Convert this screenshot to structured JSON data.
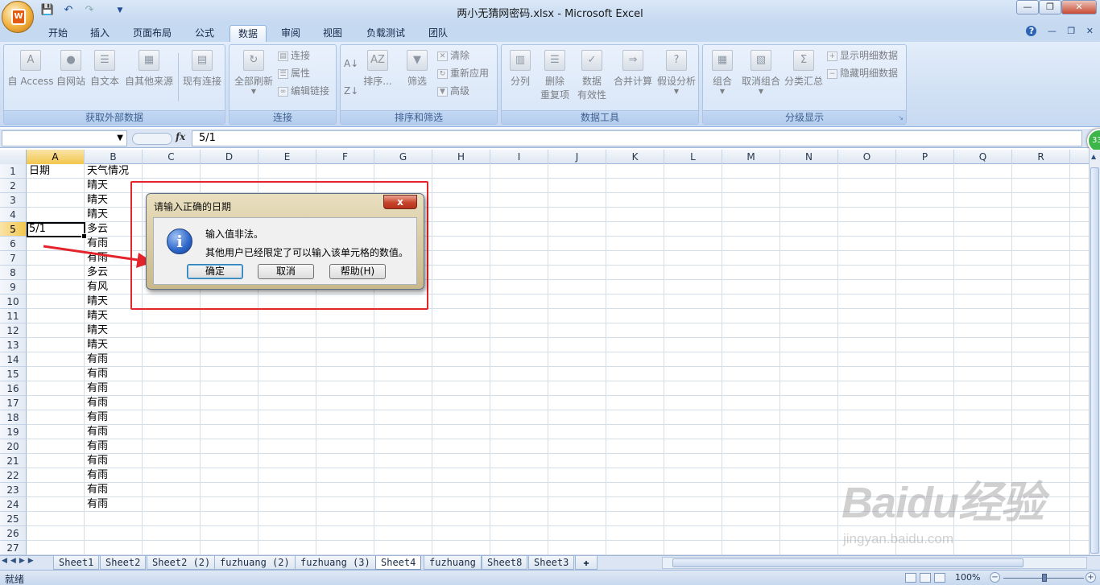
{
  "window": {
    "title": "两小无猜网密码.xlsx - Microsoft Excel"
  },
  "qat": {
    "save_icon": "save-icon",
    "undo_icon": "undo-icon",
    "redo_icon": "redo-icon",
    "customize_icon": "chevron-down-icon"
  },
  "tabs": [
    {
      "label": "开始"
    },
    {
      "label": "插入"
    },
    {
      "label": "页面布局"
    },
    {
      "label": "公式"
    },
    {
      "label": "数据"
    },
    {
      "label": "审阅"
    },
    {
      "label": "视图"
    },
    {
      "label": "负载测试"
    },
    {
      "label": "团队"
    }
  ],
  "active_tab": "数据",
  "ribbon": {
    "external": {
      "label": "获取外部数据",
      "access": "自 Access",
      "web": "自网站",
      "text": "自文本",
      "other": "自其他来源",
      "existing": "现有连接"
    },
    "connections": {
      "label": "连接",
      "refresh_all": "全部刷新",
      "connections": "连接",
      "properties": "属性",
      "edit_links": "编辑链接"
    },
    "sort_filter": {
      "label": "排序和筛选",
      "sort": "排序...",
      "filter": "筛选",
      "clear": "清除",
      "reapply": "重新应用",
      "advanced": "高级"
    },
    "data_tools": {
      "label": "数据工具",
      "text_to_columns": "分列",
      "remove_dup_1": "删除",
      "remove_dup_2": "重复项",
      "validation_1": "数据",
      "validation_2": "有效性",
      "consolidate": "合并计算",
      "whatif": "假设分析"
    },
    "outline": {
      "label": "分级显示",
      "group": "组合",
      "ungroup": "取消组合",
      "subtotal": "分类汇总",
      "show_detail": "显示明细数据",
      "hide_detail": "隐藏明细数据"
    }
  },
  "formula_bar": {
    "name_box": "",
    "fx": "fx",
    "value": "5/1"
  },
  "badge": "33",
  "columns": [
    "A",
    "B",
    "C",
    "D",
    "E",
    "F",
    "G",
    "H",
    "I",
    "J",
    "K",
    "L",
    "M",
    "N",
    "O",
    "P",
    "Q",
    "R"
  ],
  "rows": [
    "1",
    "2",
    "3",
    "4",
    "5",
    "6",
    "7",
    "8",
    "9",
    "10",
    "11",
    "12",
    "13",
    "14",
    "15",
    "16",
    "17",
    "18",
    "19",
    "20",
    "21",
    "22",
    "23",
    "24",
    "25",
    "26",
    "27"
  ],
  "cells": {
    "A1": "日期",
    "B1": "天气情况",
    "B2": "晴天",
    "B3": "晴天",
    "B4": "晴天",
    "A5": "5/1",
    "B5": "多云",
    "B6": "有雨",
    "B7": "有雨",
    "B8": "多云",
    "B9": "有风",
    "B10": "晴天",
    "B11": "晴天",
    "B12": "晴天",
    "B13": "晴天",
    "B14": "有雨",
    "B15": "有雨",
    "B16": "有雨",
    "B17": "有雨",
    "B18": "有雨",
    "B19": "有雨",
    "B20": "有雨",
    "B21": "有雨",
    "B22": "有雨",
    "B23": "有雨",
    "B24": "有雨"
  },
  "dialog": {
    "title": "请输入正确的日期",
    "message1": "输入值非法。",
    "message2": "其他用户已经限定了可以输入该单元格的数值。",
    "ok": "确定",
    "cancel": "取消",
    "help": "帮助(H)",
    "close": "x"
  },
  "sheets": [
    "Sheet1",
    "Sheet2",
    "Sheet2 (2)",
    "fuzhuang (2)",
    "fuzhuang (3)",
    "Sheet4",
    "fuzhuang",
    "Sheet8",
    "Sheet3"
  ],
  "active_sheet": "Sheet4",
  "status": {
    "ready": "就绪",
    "zoom": "100%"
  },
  "watermark": {
    "logo": "Baidu经验",
    "url": "jingyan.baidu.com"
  },
  "colors": {
    "highlight": "#e3242b",
    "accent": "#c5d9f1"
  }
}
